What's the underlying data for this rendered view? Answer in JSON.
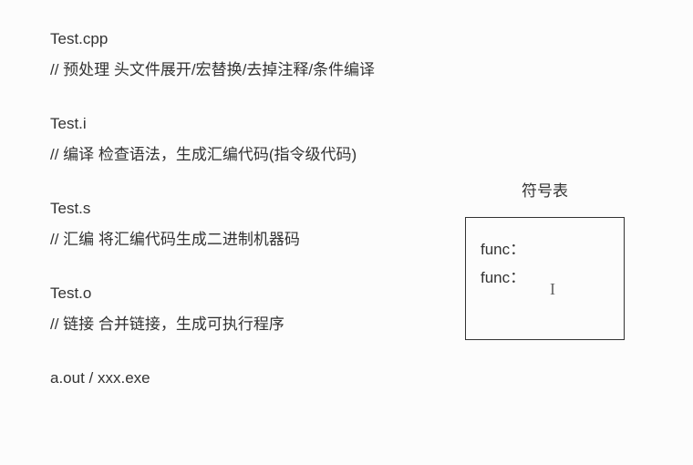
{
  "stages": [
    {
      "filename": "Test.cpp",
      "comment": "// 预处理    头文件展开/宏替换/去掉注释/条件编译"
    },
    {
      "filename": "Test.i",
      "comment": "// 编译    检查语法，生成汇编代码(指令级代码)"
    },
    {
      "filename": "Test.s",
      "comment": "// 汇编    将汇编代码生成二进制机器码"
    },
    {
      "filename": "Test.o",
      "comment": "// 链接    合并链接，生成可执行程序"
    },
    {
      "filename": "a.out / xxx.exe",
      "comment": ""
    }
  ],
  "symbol_table": {
    "title": "符号表",
    "entries": [
      "func：",
      "func："
    ]
  }
}
